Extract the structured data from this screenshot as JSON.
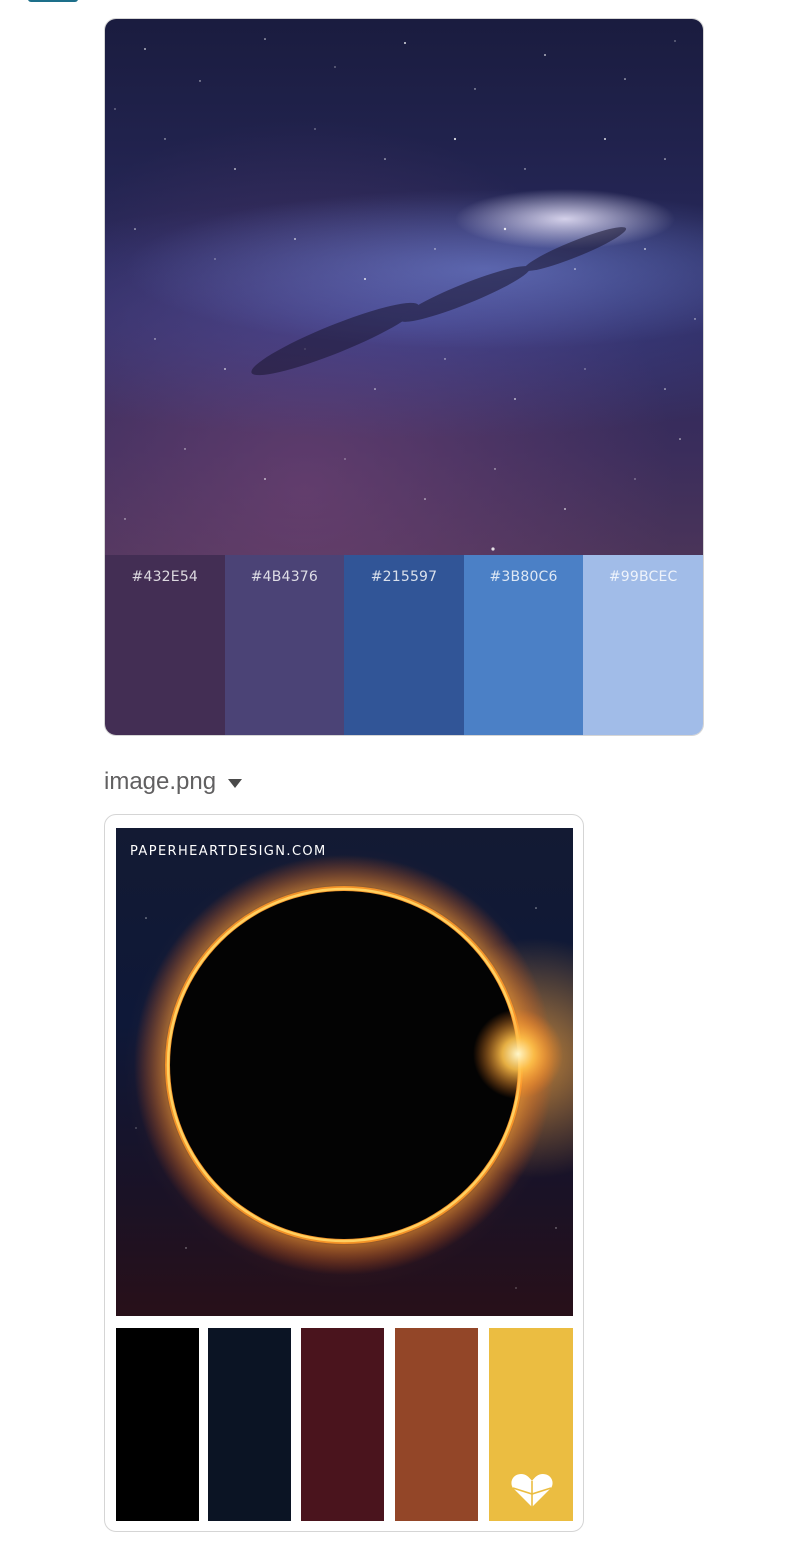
{
  "header": {
    "file_name": "image.png"
  },
  "card1": {
    "swatches": [
      {
        "hex": "#432E54",
        "label": "#432E54"
      },
      {
        "hex": "#4B4376",
        "label": "#4B4376"
      },
      {
        "hex": "#215597",
        "label": "#215597"
      },
      {
        "hex": "#3B80C6",
        "label": "#3B80C6"
      },
      {
        "hex": "#99BCEC",
        "label": "#99BCEC"
      }
    ]
  },
  "card2": {
    "brand": "PAPERHEARTDESIGN.COM",
    "swatches": [
      {
        "hex": "#000000"
      },
      {
        "hex": "#0B1424"
      },
      {
        "hex": "#4A141D"
      },
      {
        "hex": "#934628"
      },
      {
        "hex": "#EBBD41"
      }
    ]
  },
  "colors": {
    "caret": "#4a4a4a",
    "border": "#d5d5d5"
  }
}
